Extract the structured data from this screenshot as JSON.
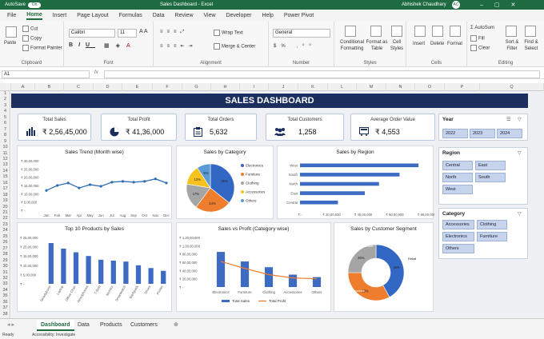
{
  "titlebar": {
    "autosave": "AutoSave",
    "toggle": "On",
    "title": "Sales Dashboard - Excel",
    "user": "Abhishek Chaudhary",
    "initials": "AC"
  },
  "menu": [
    "File",
    "Home",
    "Insert",
    "Page Layout",
    "Formulas",
    "Data",
    "Review",
    "View",
    "Developer",
    "Help",
    "Power Pivot"
  ],
  "ribbon": {
    "clipboard": {
      "label": "Clipboard",
      "paste": "Paste",
      "cut": "Cut",
      "copy": "Copy",
      "format_painter": "Format Painter"
    },
    "font": {
      "label": "Font",
      "name": "Calibri",
      "size": "11"
    },
    "alignment": {
      "label": "Alignment",
      "wrap": "Wrap Text",
      "merge": "Merge & Center"
    },
    "number": {
      "label": "Number",
      "format": "General"
    },
    "styles": {
      "label": "Styles",
      "conditional": "Conditional Formatting",
      "format_table": "Format as Table",
      "cell_styles": "Cell Styles"
    },
    "cells": {
      "label": "Cells",
      "insert": "Insert",
      "delete": "Delete",
      "format": "Format"
    },
    "editing": {
      "label": "Editing",
      "autosum": "AutoSum",
      "fill": "Fill",
      "clear": "Clear",
      "sort": "Sort & Filter",
      "find": "Find & Select"
    }
  },
  "formula_bar": {
    "name_box": "A1",
    "fx": "fx"
  },
  "columns": [
    "A",
    "B",
    "C",
    "D",
    "E",
    "F",
    "G",
    "H",
    "I",
    "J",
    "K",
    "L",
    "M",
    "N",
    "O",
    "P",
    "Q"
  ],
  "rows": [
    "1",
    "2",
    "3",
    "4",
    "5",
    "6",
    "7",
    "8",
    "9",
    "10",
    "11",
    "12",
    "13",
    "14",
    "15",
    "16",
    "17",
    "18",
    "19",
    "20",
    "21",
    "22",
    "23",
    "24",
    "25",
    "26",
    "27",
    "28",
    "29",
    "30",
    "31",
    "32",
    "33",
    "34",
    "35",
    "36",
    "37",
    "38"
  ],
  "dashboard": {
    "title": "SALES DASHBOARD",
    "kpis": [
      {
        "label": "Total Sales",
        "value": "₹ 2,56,45,000"
      },
      {
        "label": "Total Profit",
        "value": "₹ 41,36,000"
      },
      {
        "label": "Total Orders",
        "value": "5,632"
      },
      {
        "label": "Total Customers",
        "value": "1,258"
      },
      {
        "label": "Average Order Value",
        "value": "₹ 4,553"
      }
    ]
  },
  "chart_data": [
    {
      "type": "line",
      "title": "Sales Trend (Month wise)",
      "categories": [
        "Jan",
        "Feb",
        "Mar",
        "Apr",
        "May",
        "Jun",
        "Jul",
        "Aug",
        "Sep",
        "Oct",
        "Nov",
        "Dec"
      ],
      "values": [
        1200000,
        1500000,
        1650000,
        1350000,
        1550000,
        1450000,
        1700000,
        1750000,
        1700000,
        1750000,
        1900000,
        1650000
      ],
      "yticks": [
        "₹ 30,00,000",
        "₹ 25,00,000",
        "₹ 20,00,000",
        "₹ 15,00,000",
        "₹ 10,00,000",
        "₹ 5,00,000",
        "₹ -"
      ],
      "ylim": [
        0,
        3000000
      ],
      "color": "#2e6eb5"
    },
    {
      "type": "pie",
      "title": "Sales by Category",
      "categories": [
        "Electronics",
        "Furniture",
        "Clothing",
        "Accessories",
        "Others"
      ],
      "values": [
        35,
        24,
        17,
        13,
        9
      ],
      "labels": [
        "35%",
        "24%",
        "17%",
        "13%",
        "9%"
      ],
      "colors": [
        "#3367c4",
        "#ee7d2d",
        "#a5a5a5",
        "#f7c21d",
        "#5b9bd5"
      ]
    },
    {
      "type": "bar",
      "title": "Sales by Region",
      "orientation": "horizontal",
      "categories": [
        "West",
        "South",
        "North",
        "East",
        "Central"
      ],
      "values": [
        7500000,
        6300000,
        5000000,
        4100000,
        2400000
      ],
      "xticks": [
        "₹ -",
        "₹ 20,00,000",
        "₹ 40,00,000",
        "₹ 60,00,000",
        "₹ 80,00,000"
      ],
      "xlim": [
        0,
        8000000
      ],
      "color": "#3d6bc4"
    },
    {
      "type": "bar",
      "title": "Top 10 Products by Sales",
      "categories": [
        "Smartphone",
        "Laptop",
        "Office Chair",
        "Headphones",
        "T-Shirt",
        "Monitor",
        "Smartwatch",
        "Backpack",
        "Shoes",
        "Printer"
      ],
      "values": [
        2200000,
        1900000,
        1700000,
        1500000,
        1300000,
        1250000,
        1200000,
        1000000,
        850000,
        700000
      ],
      "yticks": [
        "₹ 25,00,000",
        "₹ 20,00,000",
        "₹ 15,00,000",
        "₹ 10,00,000",
        "₹ 5,00,000",
        "₹ -"
      ],
      "ylim": [
        0,
        2500000
      ],
      "color": "#3d6bc4"
    },
    {
      "type": "bar",
      "title": "Sales vs Profit (Category wise)",
      "categories": [
        "Electronics",
        "Furniture",
        "Clothing",
        "Accessories",
        "Others"
      ],
      "series": [
        {
          "name": "Total Sales",
          "values": [
            8500000,
            6200000,
            4800000,
            3000000,
            2400000
          ],
          "color": "#3d6bc4"
        },
        {
          "name": "Total Profit",
          "values": [
            6200000,
            4500000,
            3000000,
            2200000,
            2000000
          ],
          "color": "#ee7d2d",
          "kind": "line"
        }
      ],
      "yticks": [
        "₹ 1,20,00,000",
        "₹ 1,00,00,000",
        "₹ 80,00,000",
        "₹ 60,00,000",
        "₹ 40,00,000",
        "₹ 20,00,000",
        "₹ -"
      ],
      "ylim": [
        0,
        12000000
      ]
    },
    {
      "type": "pie",
      "subtype": "donut",
      "title": "Sales by Customer Segment",
      "categories": [
        "Retail",
        "Corporate",
        "Wholesale"
      ],
      "values": [
        42,
        33,
        25
      ],
      "labels": [
        "42%",
        "33%",
        "25%"
      ],
      "colors": [
        "#3367c4",
        "#ee7d2d",
        "#a5a5a5"
      ]
    }
  ],
  "slicers": {
    "year": {
      "title": "Year",
      "items": [
        "2022",
        "2023",
        "2024"
      ]
    },
    "region": {
      "title": "Region",
      "items": [
        "Central",
        "East",
        "North",
        "South",
        "West"
      ]
    },
    "category": {
      "title": "Category",
      "items": [
        "Accessories",
        "Clothing",
        "Electronics",
        "Furniture",
        "Others"
      ]
    }
  },
  "sheets": [
    "Dashboard",
    "Data",
    "Products",
    "Customers"
  ],
  "status": {
    "ready": "Ready",
    "accessibility": "Accessibility: Investigate"
  }
}
